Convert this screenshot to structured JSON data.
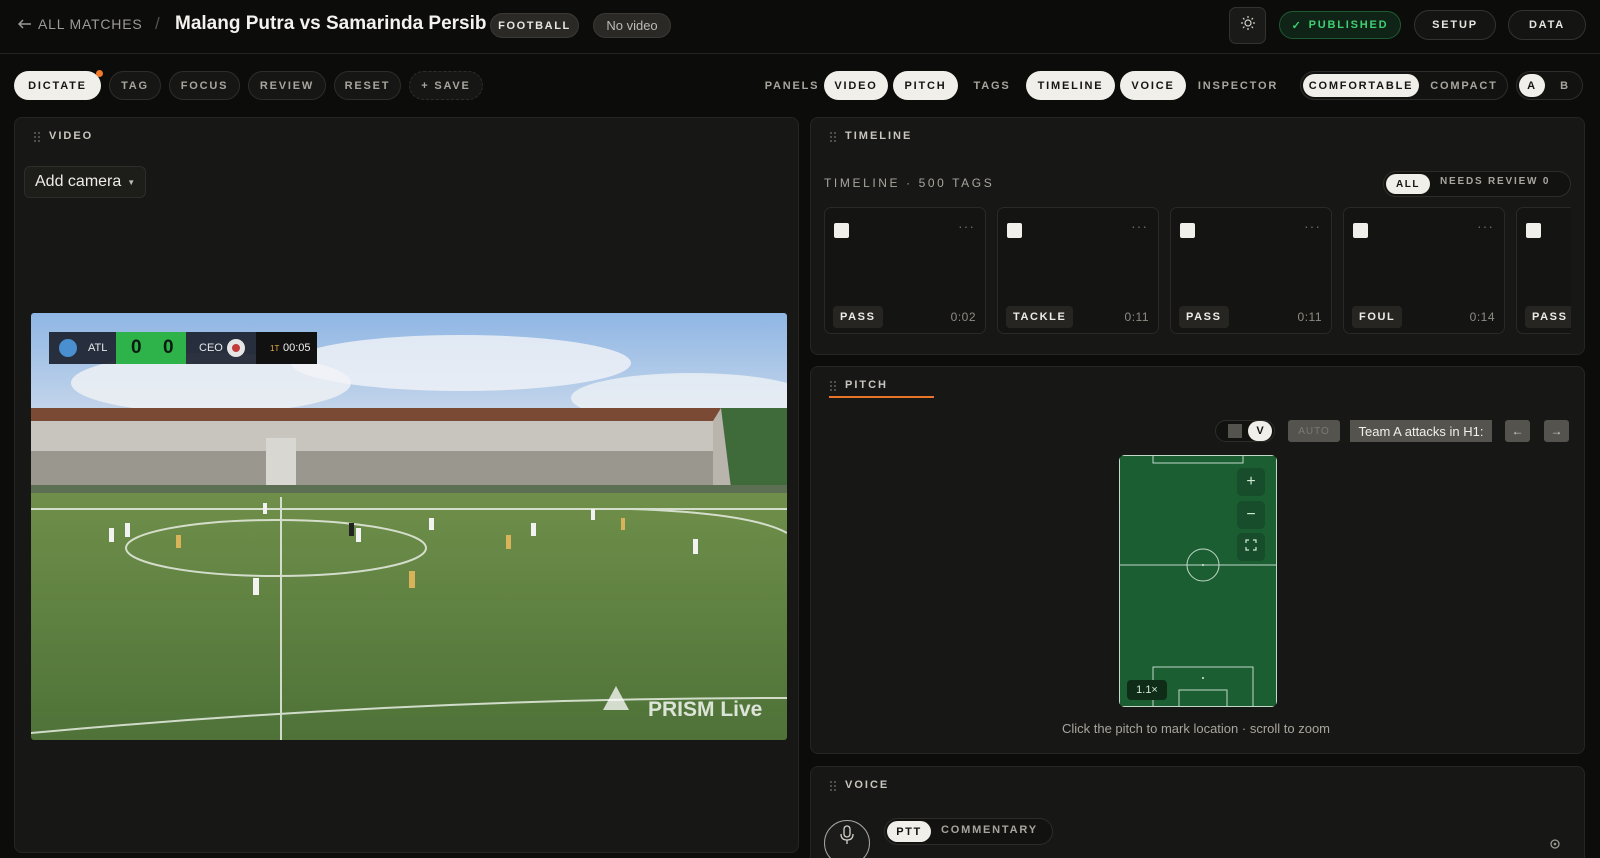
{
  "header": {
    "back_label": "ALL MATCHES",
    "separator": "/",
    "match_title": "Malang Putra vs Samarinda Persib",
    "sport_chip": "FOOTBALL",
    "video_chip": "No video",
    "published_label": "PUBLISHED",
    "published_check": "✓",
    "setup_label": "SETUP",
    "data_label": "DATA"
  },
  "toolbar": {
    "modes": [
      {
        "label": "DICTATE",
        "active": true
      },
      {
        "label": "TAG",
        "active": false
      },
      {
        "label": "FOCUS",
        "active": false
      },
      {
        "label": "REVIEW",
        "active": false
      },
      {
        "label": "RESET",
        "active": false
      },
      {
        "label": "+ SAVE",
        "active": false
      }
    ],
    "panels_label": "PANELS",
    "panels": [
      {
        "label": "VIDEO",
        "active": true
      },
      {
        "label": "PITCH",
        "active": true
      },
      {
        "label": "TAGS",
        "active": false
      },
      {
        "label": "TIMELINE",
        "active": true
      },
      {
        "label": "VOICE",
        "active": true
      },
      {
        "label": "INSPECTOR",
        "active": false
      }
    ],
    "density": [
      {
        "label": "COMFORTABLE",
        "active": true
      },
      {
        "label": "COMPACT",
        "active": false
      }
    ],
    "layouts": [
      {
        "label": "A",
        "active": true
      },
      {
        "label": "B",
        "active": false
      }
    ]
  },
  "video_panel": {
    "title": "VIDEO",
    "add_camera_label": "Add camera",
    "scoreboard": {
      "home": "ATL",
      "home_score": "0",
      "away_score": "0",
      "away": "CEO",
      "period": "1T",
      "clock": "00:05"
    },
    "watermark": "PRISM Live"
  },
  "timeline_panel": {
    "title": "TIMELINE",
    "heading": "TIMELINE · 500 TAGS",
    "filter_all": "ALL",
    "filter_review": "NEEDS REVIEW 0",
    "cards": [
      {
        "label": "PASS",
        "time": "0:02"
      },
      {
        "label": "TACKLE",
        "time": "0:11"
      },
      {
        "label": "PASS",
        "time": "0:11"
      },
      {
        "label": "FOUL",
        "time": "0:14"
      },
      {
        "label": "PASS",
        "time": ""
      }
    ],
    "more_glyph": "···"
  },
  "pitch_panel": {
    "title": "PITCH",
    "orientation_h": "H",
    "orientation_v": "V",
    "auto_label": "AUTO",
    "attack_label": "Team A attacks in H1:",
    "arrow_left": "←",
    "arrow_right": "→",
    "zoom_in": "+",
    "zoom_out": "−",
    "zoom_level": "1.1×",
    "hint": "Click the pitch to mark location · scroll to zoom"
  },
  "voice_panel": {
    "title": "VOICE",
    "ptt_label": "PTT",
    "commentary_label": "COMMENTARY"
  },
  "colors": {
    "background": "#0c0c0b",
    "panel": "#171715",
    "accent_orange": "#e8752c",
    "published_green": "#3fcf72",
    "pitch_green": "#1b5e32",
    "chip_active": "#f1efe9"
  },
  "icons": [
    "arrow-left-icon",
    "sun-icon",
    "check-icon",
    "chevron-down-icon",
    "grip-icon",
    "more-icon",
    "plus-icon",
    "minus-icon",
    "expand-icon",
    "mic-icon",
    "gear-icon"
  ]
}
